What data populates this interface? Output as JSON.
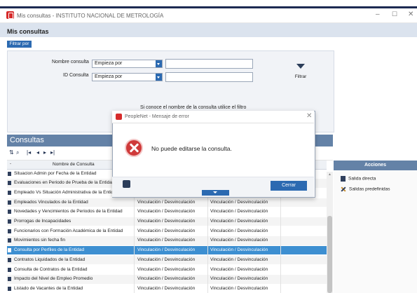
{
  "window": {
    "title": "Mis consultas - INSTITUTO NACIONAL DE METROLOGÍA",
    "controls": [
      "–",
      "☐",
      "✕"
    ]
  },
  "app_title": "Mis consultas",
  "filtrar_por": "Filtrar por",
  "filter": {
    "nombre_label": "Nombre consulta",
    "nombre_op": "Empieza por",
    "id_label": "ID Consulta",
    "id_op": "Empieza por",
    "filtrar_button": "Filtrar"
  },
  "hint": "Si conoce el nombre de la consulta utilice el filtro",
  "consultas": {
    "header": "Consultas",
    "column_header": "Nombre de Consulta",
    "rows": [
      {
        "name": "Situacion Admin por Fecha de la Entidad",
        "c2": "",
        "c3": ""
      },
      {
        "name": "Evaluaciones en Periodo de Prueba de la Entidad",
        "c2": "",
        "c3": ""
      },
      {
        "name": "Empleado Vs Situación Administrativa de la Entidad",
        "c2": "",
        "c3": ""
      },
      {
        "name": "Empleados Vinculados de la Entidad",
        "c2": "Vinculación / Desvinculación",
        "c3": "Vinculación / Desvinculación"
      },
      {
        "name": "Novedades y Vencimientos de Periodos de la Entidad",
        "c2": "Vinculación / Desvinculación",
        "c3": "Vinculación / Desvinculación"
      },
      {
        "name": "Prorrogas de Incapacidades",
        "c2": "Vinculación / Desvinculación",
        "c3": "Vinculación / Desvinculación"
      },
      {
        "name": "Funcionarios con Formación Académica de la Entidad",
        "c2": "Vinculación / Desvinculación",
        "c3": "Vinculación / Desvinculación"
      },
      {
        "name": "Movimientos sin fecha fin",
        "c2": "Vinculación / Desvinculación",
        "c3": "Vinculación / Desvinculación"
      },
      {
        "name": "Consulta por Perfiles de la Entidad",
        "c2": "Vinculación / Desvinculación",
        "c3": "Vinculación / Desvinculación"
      },
      {
        "name": "Contratos Liquidados de la Entidad",
        "c2": "Vinculación / Desvinculación",
        "c3": "Vinculación / Desvinculación"
      },
      {
        "name": "Consulta de Contratos de la Entidad",
        "c2": "Vinculación / Desvinculación",
        "c3": "Vinculación / Desvinculación"
      },
      {
        "name": "Impacto del Nivel de Empleo Promedio",
        "c2": "Vinculación / Desvinculación",
        "c3": "Vinculación / Desvinculación"
      },
      {
        "name": "Listado de Vacantes de la Entidad",
        "c2": "Vinculación / Desvinculación",
        "c3": "Vinculación / Desvinculación"
      }
    ]
  },
  "acciones": {
    "header": "Acciones",
    "items": [
      "Salida directa",
      "Salidas predefinidas"
    ]
  },
  "dialog": {
    "title": "PeopleNet - Mensaje de error",
    "message": "No puede editarse la consulta.",
    "close_button": "Cerrar"
  }
}
